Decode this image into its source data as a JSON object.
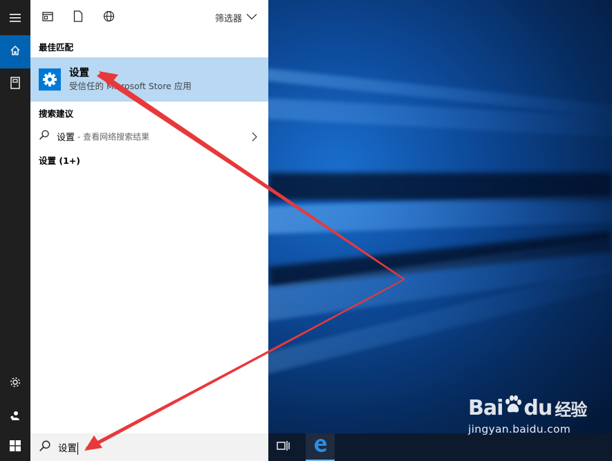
{
  "start_menu": {
    "filter_label": "筛选器",
    "best_match_heading": "最佳匹配",
    "best_match": {
      "title": "设置",
      "subtitle": "受信任的 Microsoft Store 应用"
    },
    "suggestions_heading": "搜索建议",
    "suggestion": {
      "term": "设置",
      "hint": "- 查看网络搜索结果"
    },
    "more_results_heading": "设置 (1+)"
  },
  "search_box": {
    "value": "设置"
  },
  "watermark": {
    "logo_left": "Bai",
    "logo_right": "du",
    "logo_cn": "经验",
    "url": "jingyan.baidu.com"
  },
  "colors": {
    "accent": "#0078d7",
    "rail": "#1f1f1f",
    "highlight": "#b8d8f3",
    "arrow": "#e8383b"
  },
  "icons": {
    "rail": [
      "hamburger-icon",
      "home-icon",
      "notebook-icon",
      "gear-icon",
      "user-icon"
    ],
    "topbar": [
      "apps-icon",
      "document-icon",
      "globe-icon"
    ],
    "taskbar": [
      "windows-logo-icon",
      "task-view-icon",
      "edge-icon"
    ]
  }
}
